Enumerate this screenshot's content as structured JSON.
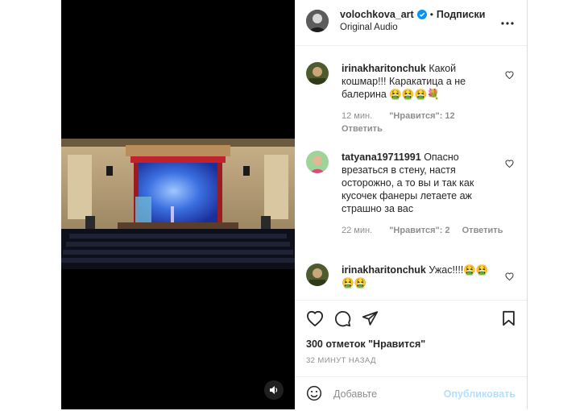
{
  "post": {
    "username": "volochkova_art",
    "separator": "•",
    "follow_label": "Подписки",
    "audio": "Original Audio"
  },
  "comments": [
    {
      "user": "irinakharitonchuk",
      "text": "Какой кошмар!!! Каракатица а не балерина 🤮🤮🤮💐",
      "time": "12 мин.",
      "likes": "\"Нравится\": 12",
      "reply": "Ответить"
    },
    {
      "user": "tatyana19711991",
      "text": "Опасно врезаться в стену, настя осторожно, а то вы и так как кусочек фанеры летаете аж страшно за вас",
      "time": "22 мин.",
      "likes": "\"Нравится\": 2",
      "reply": "Ответить"
    },
    {
      "user": "irinakharitonchuk",
      "text": "Ужас!!!!🤮🤮🤮🤮"
    }
  ],
  "likes_count": "300 отметок \"Нравится\"",
  "posted_time": "32 МИНУТ НАЗАД",
  "comment_input": {
    "placeholder": "Добавьте"
  },
  "publish_label": "Опубликовать",
  "colors": {
    "verified": "#0095f6",
    "publish_disabled": "#b2dffc",
    "stage_blue": "#3b6fe0"
  }
}
